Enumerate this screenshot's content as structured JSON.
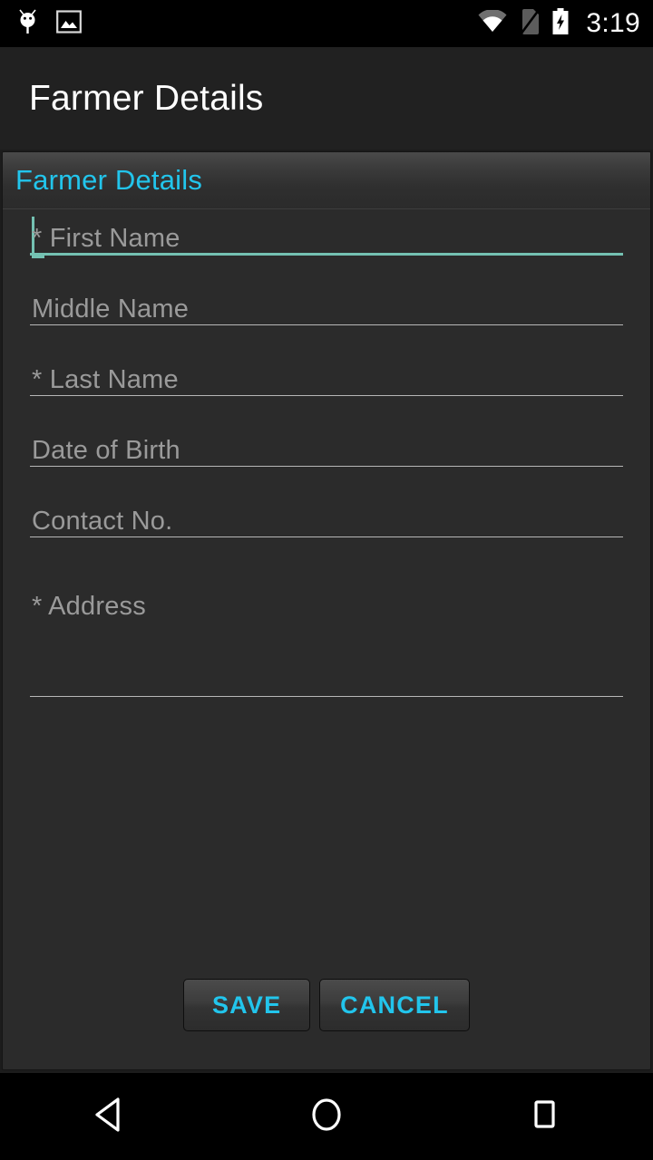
{
  "statusbar": {
    "time": "3:19",
    "left_icons": [
      {
        "name": "android-bug-icon"
      },
      {
        "name": "image-icon"
      }
    ],
    "right_icons": [
      {
        "name": "wifi-icon"
      },
      {
        "name": "no-sim-icon"
      },
      {
        "name": "battery-charging-icon"
      }
    ]
  },
  "appbar": {
    "title": "Farmer Details"
  },
  "form": {
    "section_title": "Farmer Details",
    "fields": [
      {
        "name": "first-name",
        "placeholder": "* First Name",
        "value": "",
        "focused": true,
        "multiline": false
      },
      {
        "name": "middle-name",
        "placeholder": "Middle Name",
        "value": "",
        "focused": false,
        "multiline": false
      },
      {
        "name": "last-name",
        "placeholder": "* Last Name",
        "value": "",
        "focused": false,
        "multiline": false
      },
      {
        "name": "date-of-birth",
        "placeholder": "Date of Birth",
        "value": "",
        "focused": false,
        "multiline": false
      },
      {
        "name": "contact-no",
        "placeholder": "Contact No.",
        "value": "",
        "focused": false,
        "multiline": false
      },
      {
        "name": "address",
        "placeholder": "* Address",
        "value": "",
        "focused": false,
        "multiline": true
      }
    ],
    "buttons": {
      "save_label": "SAVE",
      "cancel_label": "CANCEL"
    }
  },
  "navbar": {
    "back_label": "Back",
    "home_label": "Home",
    "recents_label": "Recents"
  },
  "colors": {
    "accent_cyan": "#22c5ec",
    "focus_teal": "#74c1b2",
    "card_bg": "#2b2b2b",
    "appbar_bg": "#212121",
    "placeholder_gray": "#9a9a9a",
    "underline_gray": "#b7b7b7"
  }
}
